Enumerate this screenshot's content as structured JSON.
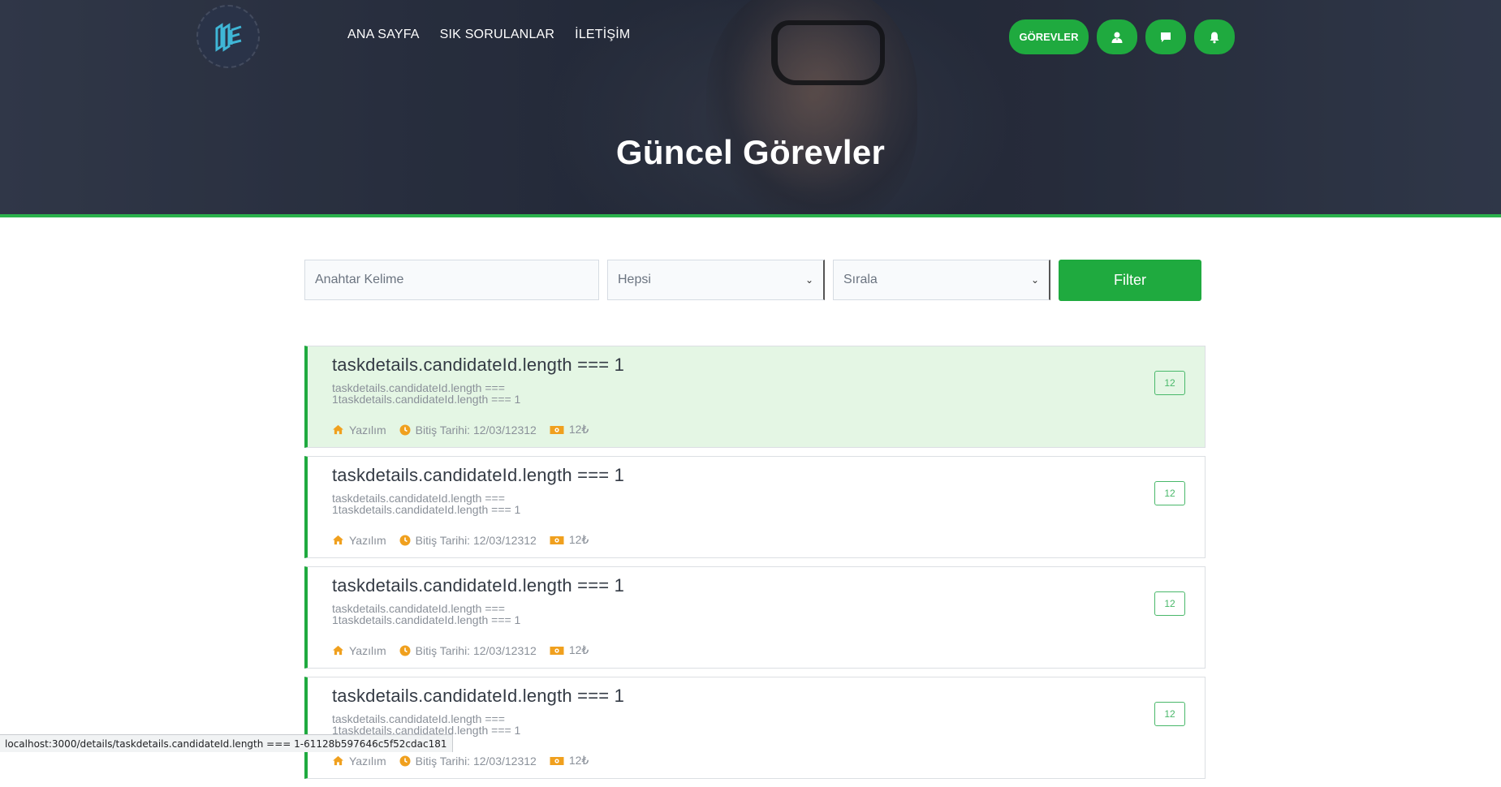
{
  "nav": {
    "items": [
      "ANA SAYFA",
      "SIK SORULANLAR",
      "İLETİŞİM"
    ]
  },
  "header_actions": {
    "tasks_label": "GÖREVLER",
    "icons": [
      "user-icon",
      "message-icon",
      "bell-icon"
    ]
  },
  "hero": {
    "title": "Güncel Görevler"
  },
  "filter": {
    "keyword_placeholder": "Anahtar Kelime",
    "category_value": "Hepsi",
    "sort_value": "Sırala",
    "button_label": "Filter"
  },
  "tasks": [
    {
      "title": "taskdetails.candidateId.length === 1",
      "desc_line1": "taskdetails.candidateId.length ===",
      "desc_line2": "1taskdetails.candidateId.length === 1",
      "category": "Yazılım",
      "deadline": "Bitiş Tarihi: 12/03/12312",
      "price": "12₺",
      "badge": "12"
    },
    {
      "title": "taskdetails.candidateId.length === 1",
      "desc_line1": "taskdetails.candidateId.length ===",
      "desc_line2": "1taskdetails.candidateId.length === 1",
      "category": "Yazılım",
      "deadline": "Bitiş Tarihi: 12/03/12312",
      "price": "12₺",
      "badge": "12"
    },
    {
      "title": "taskdetails.candidateId.length === 1",
      "desc_line1": "taskdetails.candidateId.length ===",
      "desc_line2": "1taskdetails.candidateId.length === 1",
      "category": "Yazılım",
      "deadline": "Bitiş Tarihi: 12/03/12312",
      "price": "12₺",
      "badge": "12"
    },
    {
      "title": "taskdetails.candidateId.length === 1",
      "desc_line1": "taskdetails.candidateId.length ===",
      "desc_line2": "1taskdetails.candidateId.length === 1",
      "category": "Yazılım",
      "deadline": "Bitiş Tarihi: 12/03/12312",
      "price": "12₺",
      "badge": "12"
    }
  ],
  "status_bar": {
    "url": "localhost:3000/details/taskdetails.candidateId.length === 1-61128b597646c5f52cdac181"
  },
  "colors": {
    "accent": "#1faa3f",
    "active_card": "#e4f6e4",
    "meta_icon": "#f0a01e"
  }
}
